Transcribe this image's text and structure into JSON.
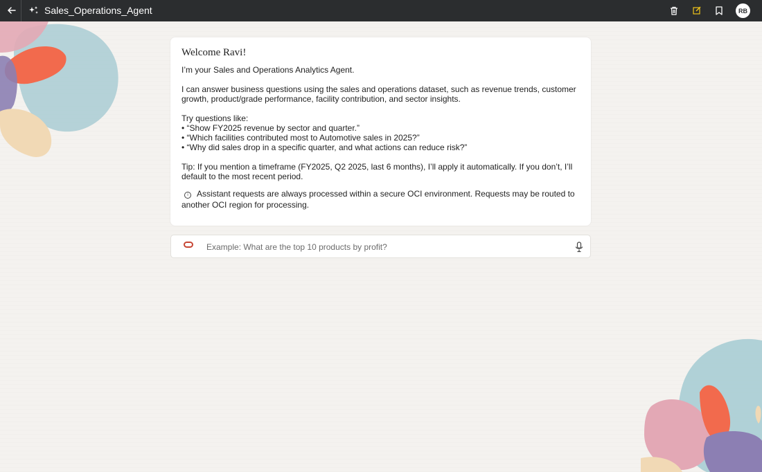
{
  "topbar": {
    "title": "Sales_Operations_Agent",
    "avatar_initials": "RB",
    "icons": [
      "back-arrow-icon",
      "agent-sparkle-icon",
      "trash-icon",
      "edit-icon",
      "bookmark-icon"
    ],
    "edit_icon_color": "#f0c419"
  },
  "card": {
    "welcome": "Welcome Ravi!",
    "intro": "I’m your Sales and Operations Analytics Agent.",
    "capability": "I can answer business questions using the sales and operations dataset, such as revenue trends, customer growth, product/grade performance, facility contribution, and sector insights.",
    "try_heading": "Try questions like:",
    "examples": [
      "• “Show FY2025 revenue by sector and quarter.”",
      "• “Which facilities contributed most to Automotive sales in 2025?”",
      "• “Why did sales drop in a specific quarter, and what actions can reduce risk?”"
    ],
    "tip": "Tip: If you mention a timeframe (FY2025, Q2 2025, last 6 months), I’ll apply it automatically. If you don’t, I’ll default to the most recent period.",
    "notice": "Assistant requests are always processed within a secure OCI environment. Requests may be routed to another OCI region for processing."
  },
  "input": {
    "placeholder": "Example: What are the top 10 products by profit?",
    "value": ""
  },
  "colors": {
    "topbar_bg": "#2b2d2f",
    "page_bg": "#f4f2ef",
    "oracle_red": "#c74634"
  }
}
